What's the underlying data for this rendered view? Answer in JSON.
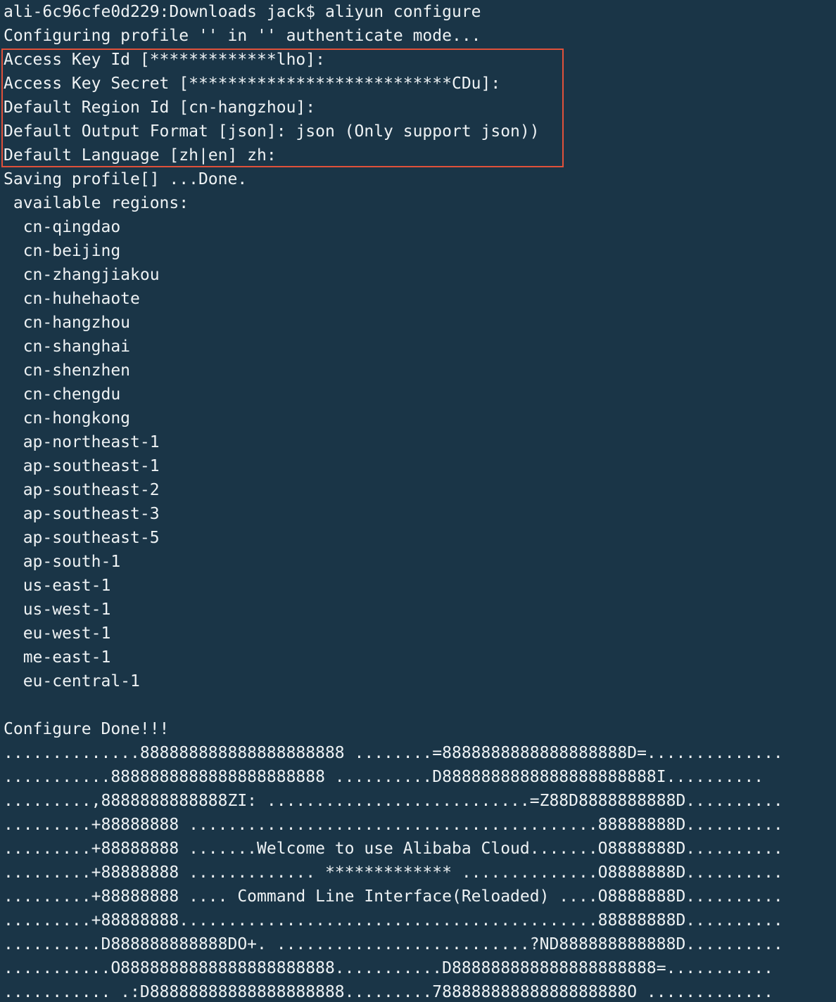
{
  "terminal": {
    "highlight_color": "#e0513a",
    "background_color": "#1a3547",
    "text_color": "#eef2f4",
    "lines": [
      "ali-6c96cfe0d229:Downloads jack$ aliyun configure",
      "Configuring profile '' in '' authenticate mode...",
      "Access Key Id [*************lho]:",
      "Access Key Secret [***************************CDu]:",
      "Default Region Id [cn-hangzhou]:",
      "Default Output Format [json]: json (Only support json))",
      "Default Language [zh|en] zh:",
      "Saving profile[] ...Done.",
      " available regions:",
      "  cn-qingdao",
      "  cn-beijing",
      "  cn-zhangjiakou",
      "  cn-huhehaote",
      "  cn-hangzhou",
      "  cn-shanghai",
      "  cn-shenzhen",
      "  cn-chengdu",
      "  cn-hongkong",
      "  ap-northeast-1",
      "  ap-southeast-1",
      "  ap-southeast-2",
      "  ap-southeast-3",
      "  ap-southeast-5",
      "  ap-south-1",
      "  us-east-1",
      "  us-west-1",
      "  eu-west-1",
      "  me-east-1",
      "  eu-central-1",
      "",
      "Configure Done!!!",
      "..............888888888888888888888 ........=8888888888888888888D=..............",
      "...........8888888888888888888888 ..........D8888888888888888888888I..........",
      ".........,8888888888888ZI: ...........................=Z88D8888888888D..........",
      ".........+88888888 ..........................................88888888D..........",
      ".........+88888888 .......Welcome to use Alibaba Cloud.......O8888888D..........",
      ".........+88888888 ............. ************* ..............O8888888D..........",
      ".........+88888888 .... Command Line Interface(Reloaded) ....O8888888D..........",
      ".........+88888888...........................................88888888D..........",
      "..........D888888888888DO+. ..........................?ND888888888888D..........",
      "...........O8888888888888888888888...........D888888888888888888888=...........",
      "........... .:D88888888888888888888.........78888888888888888888O ............."
    ]
  }
}
